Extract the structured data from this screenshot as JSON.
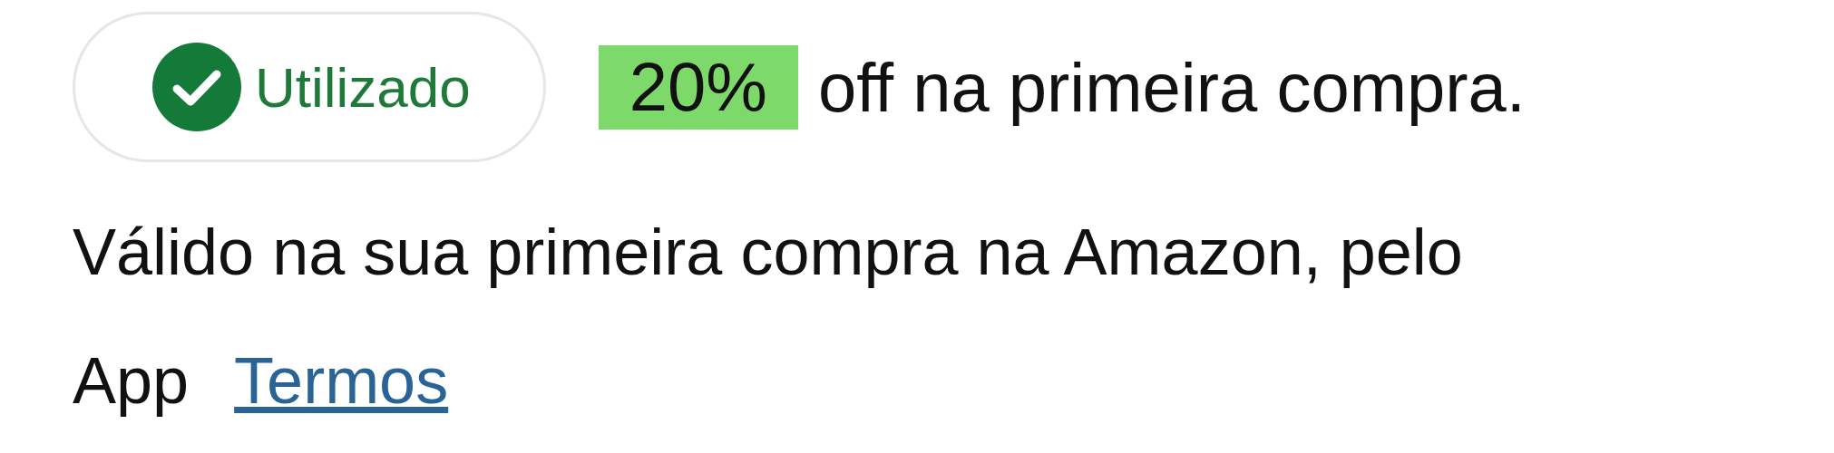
{
  "coupon": {
    "status": {
      "label": "Utilizado",
      "used": true
    },
    "discount": "20%",
    "offer_text": "off na primeira compra."
  },
  "description": "Válido na sua primeira compra na Amazon, pelo App",
  "terms_link": "Termos"
}
